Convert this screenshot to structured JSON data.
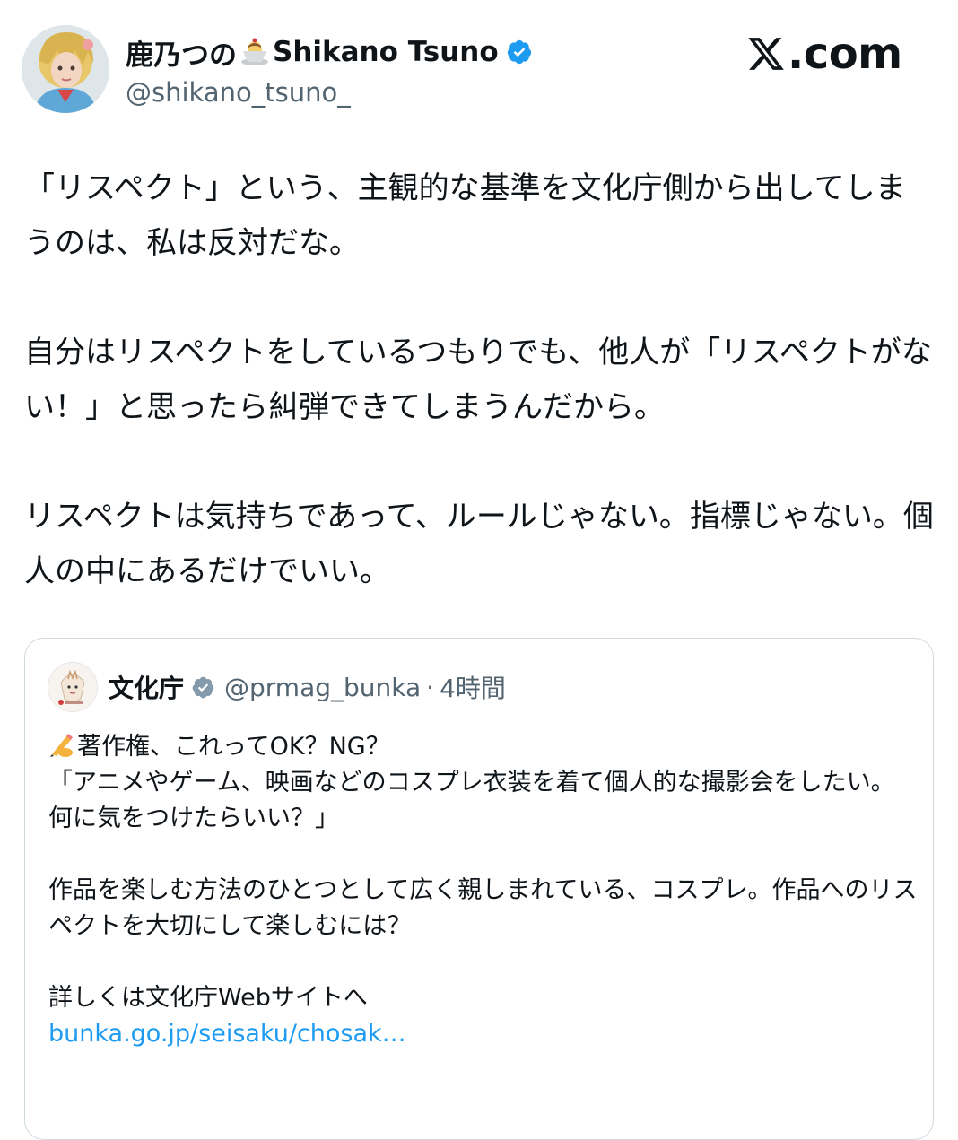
{
  "author": {
    "display_name_jp": "鹿乃つの",
    "name_emoji": "pudding-emoji",
    "display_name_en": "Shikano Tsuno",
    "verified": true,
    "handle": "@shikano_tsuno_"
  },
  "brand": {
    "logo_text": ".com",
    "logo_icon": "x-logo-icon"
  },
  "tweet": {
    "paragraphs": [
      "「リスペクト」という、主観的な基準を文化庁側から出してしまうのは、私は反対だな。",
      "自分はリスペクトをしているつもりでも、他人が「リスペクトがない！」と思ったら糾弾できてしまうんだから。",
      "リスペクトは気持ちであって、ルールじゃない。指標じゃない。個人の中にあるだけでいい。"
    ]
  },
  "quoted": {
    "name": "文化庁",
    "verified": true,
    "handle": "@prmag_bunka",
    "separator": "·",
    "time": "4時間",
    "emoji": "writing-hand-emoji",
    "lines": {
      "l1": "著作権、これってOK？NG？",
      "l2": "「アニメやゲーム、映画などのコスプレ衣装を着て個人的な撮影会をしたい。何に気をつけたらいい？」",
      "p2": "作品を楽しむ方法のひとつとして広く親しまれている、コスプレ。作品へのリスペクトを大切にして楽しむには？",
      "p3": "詳しくは文化庁Webサイトへ",
      "link": "bunka.go.jp/seisaku/chosak…"
    }
  },
  "colors": {
    "text": "#0f1419",
    "secondary": "#536471",
    "link": "#1d9bf0",
    "verified": "#1d9bf0",
    "border": "#cfd9de"
  }
}
